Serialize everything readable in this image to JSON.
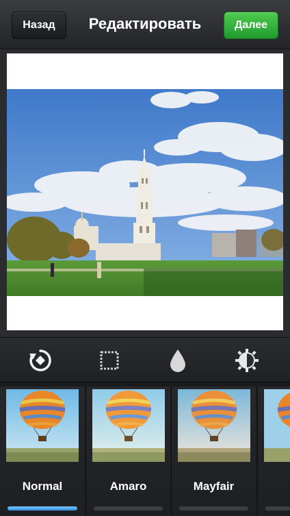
{
  "header": {
    "back_label": "Назад",
    "title": "Редактировать",
    "next_label": "Далее"
  },
  "tools": [
    {
      "icon": "rotate-icon"
    },
    {
      "icon": "frame-icon"
    },
    {
      "icon": "blur-drop-icon"
    },
    {
      "icon": "brightness-icon"
    }
  ],
  "filters": [
    {
      "label": "Normal",
      "selected": true
    },
    {
      "label": "Amaro",
      "selected": false
    },
    {
      "label": "Mayfair",
      "selected": false
    }
  ],
  "colors": {
    "next_button": "#2ea63a",
    "active_filter_bar": "#3a9bea",
    "background": "#2b2d30"
  }
}
